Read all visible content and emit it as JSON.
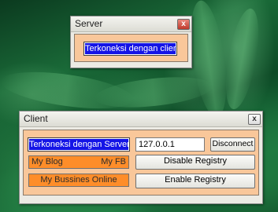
{
  "server_window": {
    "title": "Server",
    "close_glyph": "x",
    "status_text": "Terkoneksi dengan client..."
  },
  "client_window": {
    "title": "Client",
    "close_glyph": "x",
    "status_text": "Terkoneksi dengan Server",
    "ip_value": "127.0.0.1",
    "disconnect_label": "Disconnect",
    "my_blog_label": "My Blog",
    "my_fb_label": "My FB",
    "bussines_label": "My Bussines Online",
    "disable_registry_label": "Disable Registry",
    "enable_registry_label": "Enable Registry"
  },
  "colors": {
    "panel_bg": "#f9c79a",
    "status_blue": "#1414e6",
    "link_orange": "#fe8d29",
    "close_red": "#c0392b"
  }
}
